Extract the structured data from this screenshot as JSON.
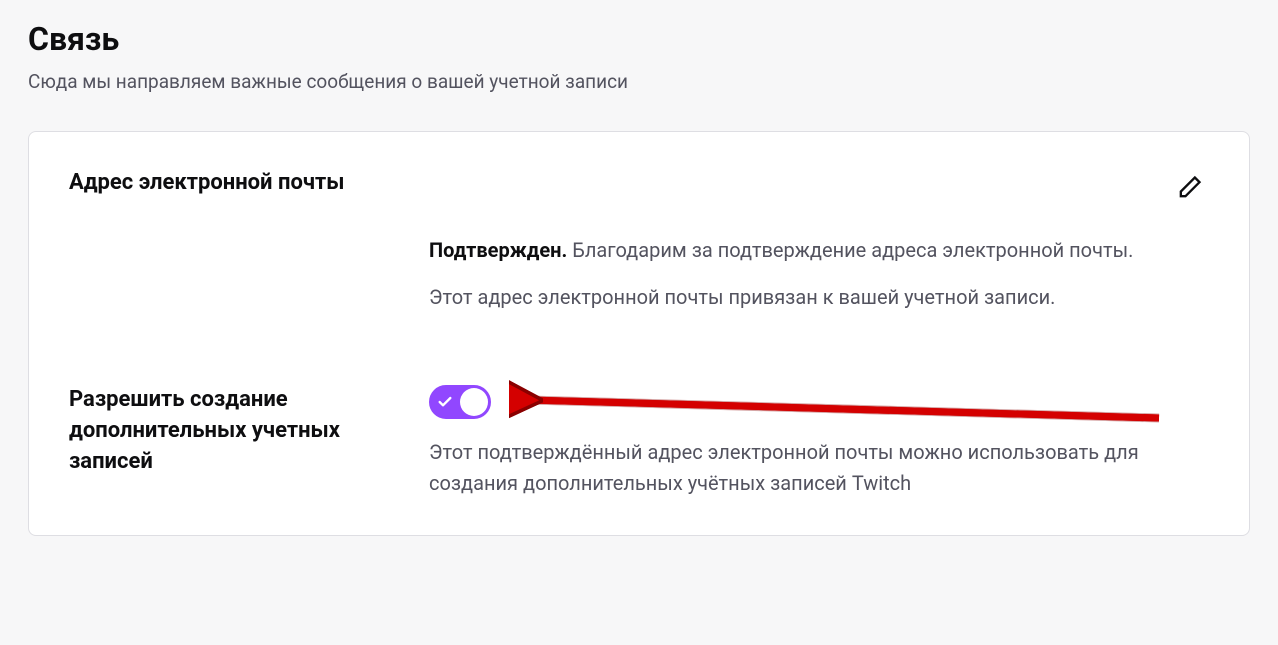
{
  "section": {
    "title": "Связь",
    "subtitle": "Сюда мы направляем важные сообщения о вашей учетной записи"
  },
  "email": {
    "label": "Адрес электронной почты",
    "verified_label": "Подтвержден.",
    "verified_text": " Благодарим за подтверждение адреса электронной почты.",
    "linked_text": "Этот адрес электронной почты привязан к вашей учетной записи."
  },
  "allow_accounts": {
    "label": "Разрешить создание дополнительных учетных записей",
    "description": "Этот подтверждённый адрес электронной почты можно использовать для создания дополнительных учётных записей Twitch",
    "enabled": true
  }
}
